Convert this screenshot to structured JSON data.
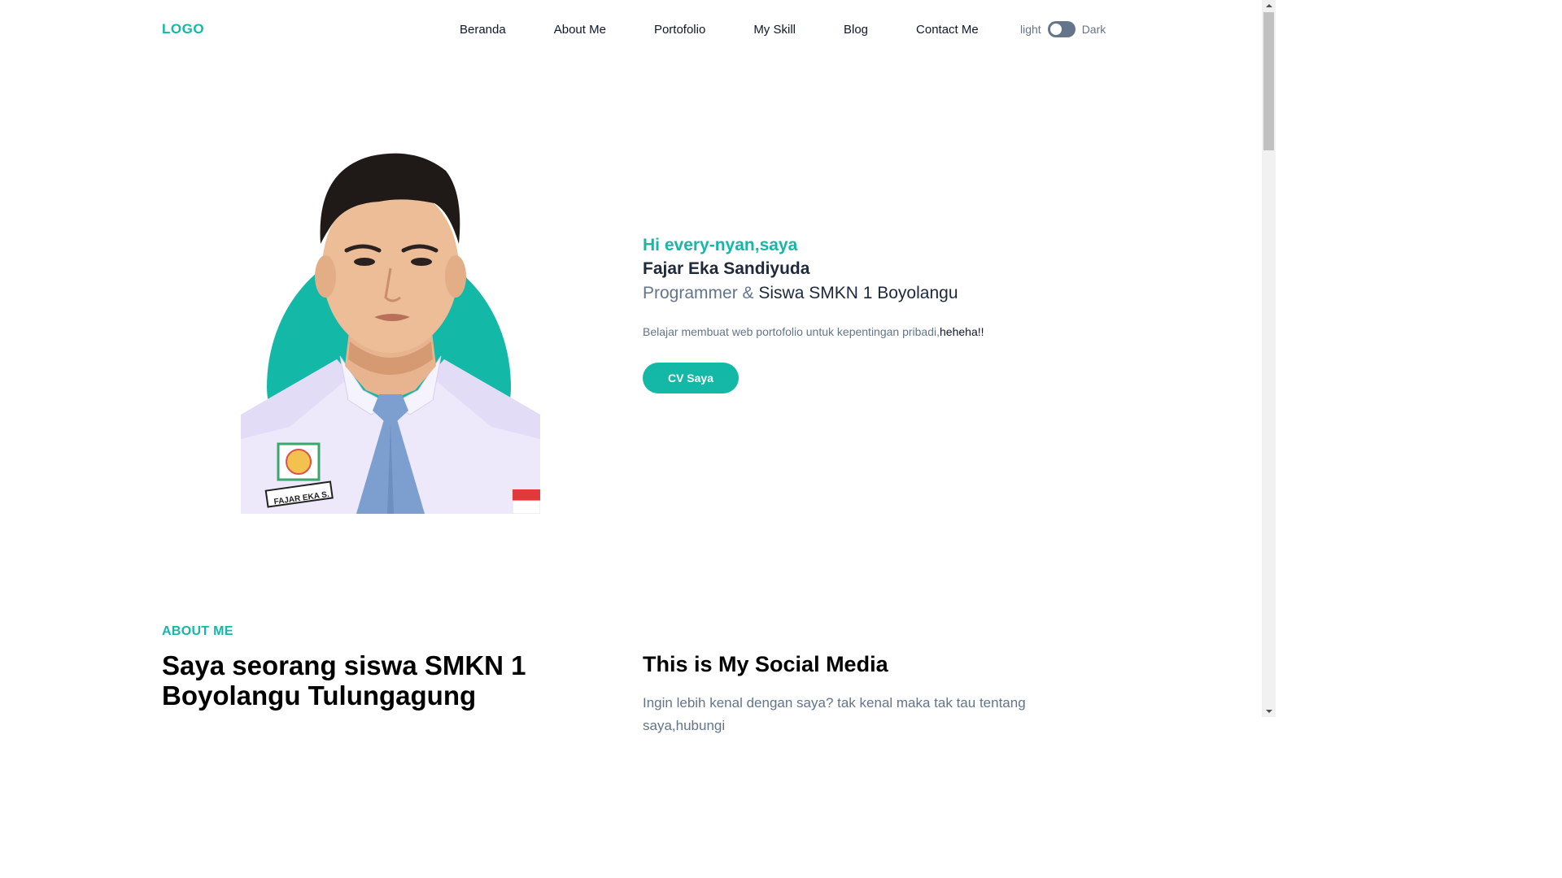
{
  "nav": {
    "logo": "LOGO",
    "links": [
      "Beranda",
      "About Me",
      "Portofolio",
      "My Skill",
      "Blog",
      "Contact Me"
    ],
    "mode_light": "light",
    "mode_dark": "Dark"
  },
  "hero": {
    "greeting": "Hi every-nyan,saya",
    "name": "Fajar Eka Sandiyuda",
    "role_prefix": "Programmer & ",
    "role_school": "Siswa SMKN 1 Boyolangu",
    "description": "Belajar membuat web portofolio untuk kepentingan pribadi,",
    "description_accent": "heheha!!",
    "cv_button": "CV Saya",
    "badge_name": "FAJAR EKA S."
  },
  "about": {
    "label": "ABOUT ME",
    "heading": "Saya seorang siswa SMKN 1 Boyolangu Tulungagung",
    "social_heading": "This is My Social Media",
    "social_text": "Ingin lebih kenal dengan saya? tak kenal maka tak tau tentang saya,hubungi"
  },
  "colors": {
    "accent": "#14b8a6",
    "dark": "#1e293b",
    "muted": "#64748b"
  }
}
